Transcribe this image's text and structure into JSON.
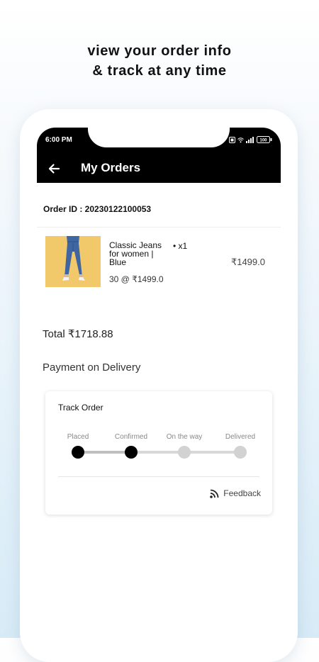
{
  "headline": {
    "line1": "view your order info",
    "line2": "& track at any time"
  },
  "statusbar": {
    "time": "6:00 PM",
    "battery": "100"
  },
  "appbar": {
    "title": "My Orders",
    "back_icon": "arrow-left-icon"
  },
  "order": {
    "id_label": "Order ID : 20230122100053",
    "item": {
      "name": "Classic Jeans for women | Blue",
      "quantity": "• x1",
      "price": "₹1499.0",
      "unit_line": "30 @ ₹1499.0"
    },
    "total": "Total ₹1718.88",
    "payment_method": "Payment on Delivery"
  },
  "tracking": {
    "title": "Track Order",
    "steps": [
      {
        "label": "Placed",
        "done": true
      },
      {
        "label": "Confirmed",
        "done": true
      },
      {
        "label": "On the way",
        "done": false
      },
      {
        "label": "Delivered",
        "done": false
      }
    ],
    "feedback_label": "Feedback",
    "feedback_icon": "rss-feed-icon"
  },
  "colors": {
    "app_bar": "#000000",
    "step_done": "#000000",
    "step_pending": "#d2d2d2",
    "product_bg": "#f1c86a",
    "jeans": "#3f66a1"
  }
}
